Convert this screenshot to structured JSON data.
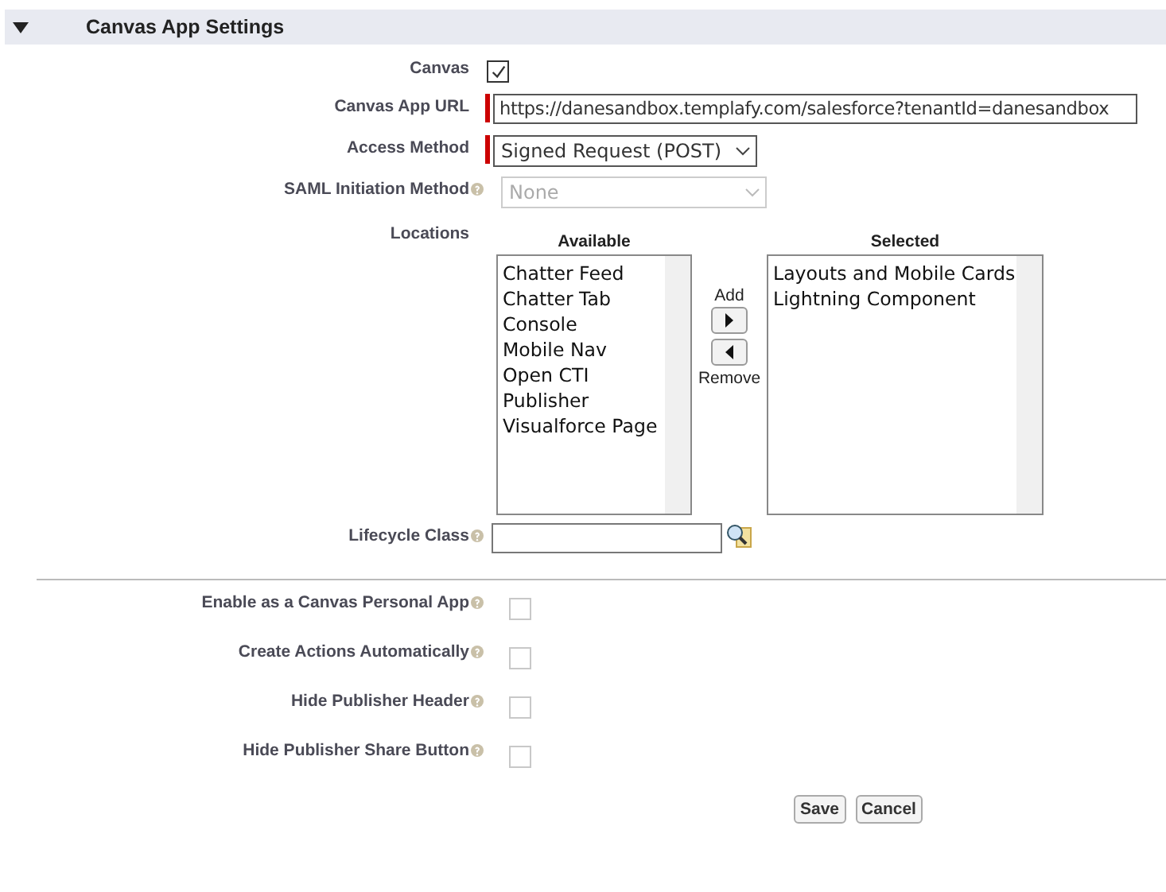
{
  "section": {
    "title": "Canvas App Settings",
    "expanded": true
  },
  "fields": [
    {
      "kind": "checkbox",
      "label": "Canvas",
      "help": false,
      "checked": true,
      "disabled": false
    },
    {
      "kind": "text",
      "label": "Canvas App URL",
      "help": false,
      "required": true,
      "value": "https://danesandbox.templafy.com/salesforce?tenantId=danesandbox"
    },
    {
      "kind": "select",
      "label": "Access Method",
      "help": false,
      "required": true,
      "disabled": false,
      "value": "Signed Request (POST)"
    },
    {
      "kind": "select",
      "label": "SAML Initiation Method",
      "help": true,
      "required": false,
      "disabled": true,
      "value": "None"
    },
    {
      "kind": "duallist",
      "label": "Locations",
      "help": false,
      "available_heading": "Available",
      "selected_heading": "Selected",
      "available": [
        "Chatter Feed",
        "Chatter Tab",
        "Console",
        "Mobile Nav",
        "Open CTI",
        "Publisher",
        "Visualforce Page"
      ],
      "selected": [
        "Layouts and Mobile Cards",
        "Lightning Component"
      ],
      "add_label": "Add",
      "remove_label": "Remove"
    },
    {
      "kind": "lookup",
      "label": "Lifecycle Class",
      "help": true,
      "required": false
    }
  ],
  "options": [
    {
      "kind": "checkbox",
      "label": "Enable as a Canvas Personal App",
      "help": true,
      "checked": false,
      "disabled": true
    },
    {
      "kind": "checkbox",
      "label": "Create Actions Automatically",
      "help": true,
      "checked": false,
      "disabled": true
    },
    {
      "kind": "checkbox",
      "label": "Hide Publisher Header",
      "help": true,
      "checked": false,
      "disabled": true
    },
    {
      "kind": "checkbox",
      "label": "Hide Publisher Share Button",
      "help": true,
      "checked": false,
      "disabled": true
    }
  ],
  "buttons": [
    "Save",
    "Cancel"
  ]
}
